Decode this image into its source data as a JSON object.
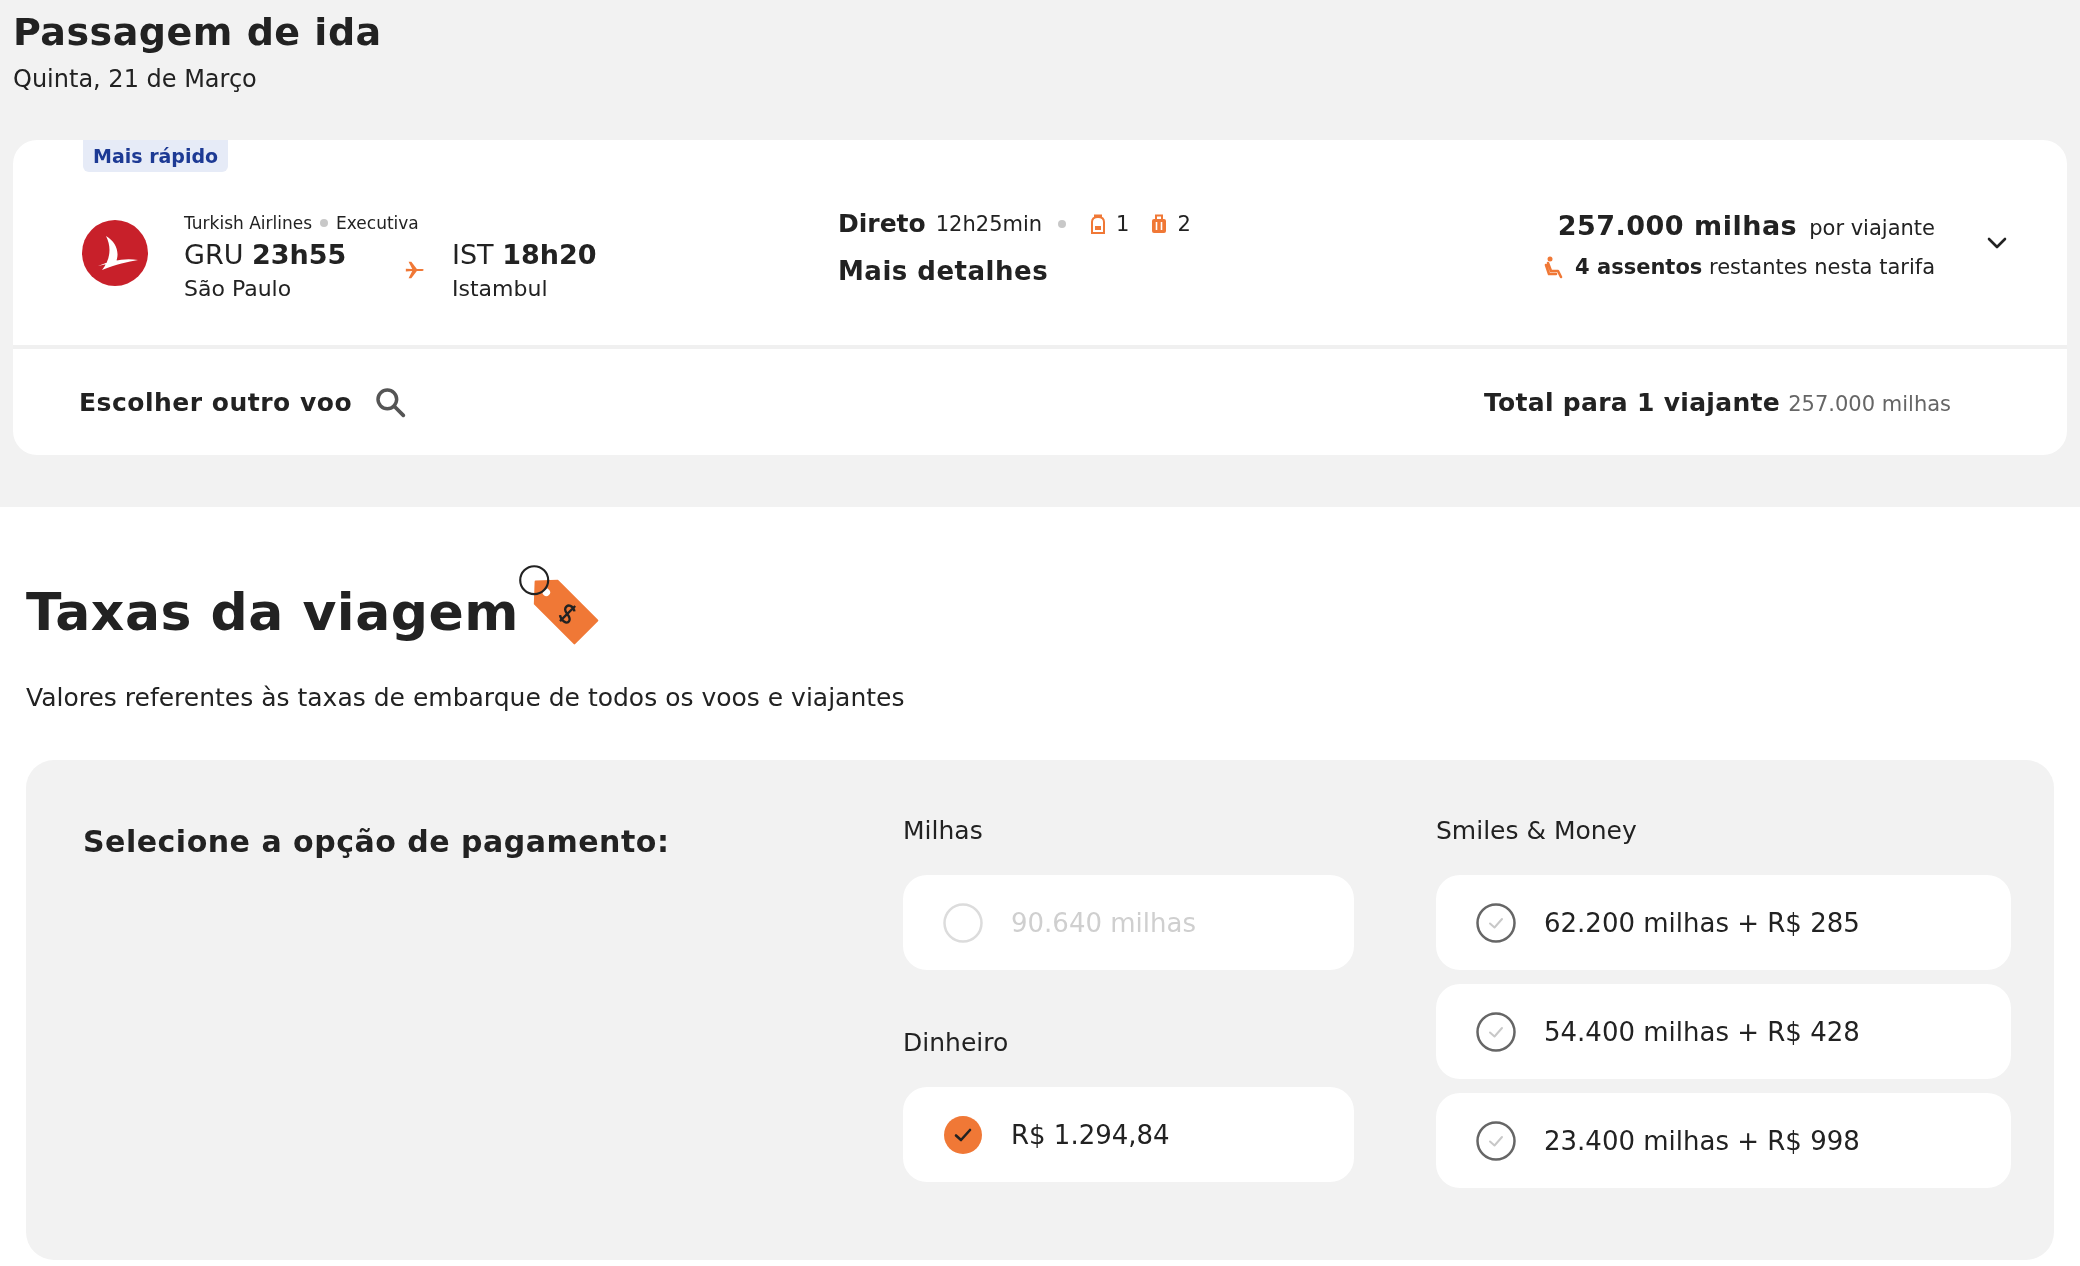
{
  "header": {
    "title": "Passagem de ida",
    "date": "Quinta, 21 de Março"
  },
  "flight": {
    "badge": "Mais rápido",
    "airline": "Turkish Airlines",
    "cabin": "Executiva",
    "origin": {
      "code": "GRU",
      "time": "23h55",
      "city": "São Paulo"
    },
    "destination": {
      "code": "IST",
      "time": "18h20",
      "city": "Istambul"
    },
    "stops": "Direto",
    "duration": "12h25min",
    "carry_on": "1",
    "checked_bags": "2",
    "details_link": "Mais detalhes",
    "price": "257.000 milhas",
    "price_unit": "por viajante",
    "seats_count": "4 assentos",
    "seats_text": "restantes nesta tarifa",
    "expanded": false
  },
  "footer": {
    "change_flight": "Escolher outro voo",
    "total_label": "Total para 1 viajante",
    "total_value": "257.000 milhas"
  },
  "fees": {
    "title": "Taxas da viagem",
    "subtitle": "Valores referentes às taxas de embarque de todos os voos e viajantes",
    "prompt": "Selecione a opção de pagamento:",
    "groups": [
      {
        "label": "Milhas",
        "options": [
          {
            "label": "90.640 milhas",
            "selected": false,
            "disabled": true
          }
        ]
      },
      {
        "label": "Dinheiro",
        "options": [
          {
            "label": "R$ 1.294,84",
            "selected": true,
            "disabled": false
          }
        ]
      },
      {
        "label": "Smiles & Money",
        "options": [
          {
            "label": "62.200 milhas + R$ 285",
            "selected": false,
            "disabled": false
          },
          {
            "label": "54.400 milhas + R$ 428",
            "selected": false,
            "disabled": false
          },
          {
            "label": "23.400 milhas + R$ 998",
            "selected": false,
            "disabled": false
          }
        ]
      }
    ]
  }
}
